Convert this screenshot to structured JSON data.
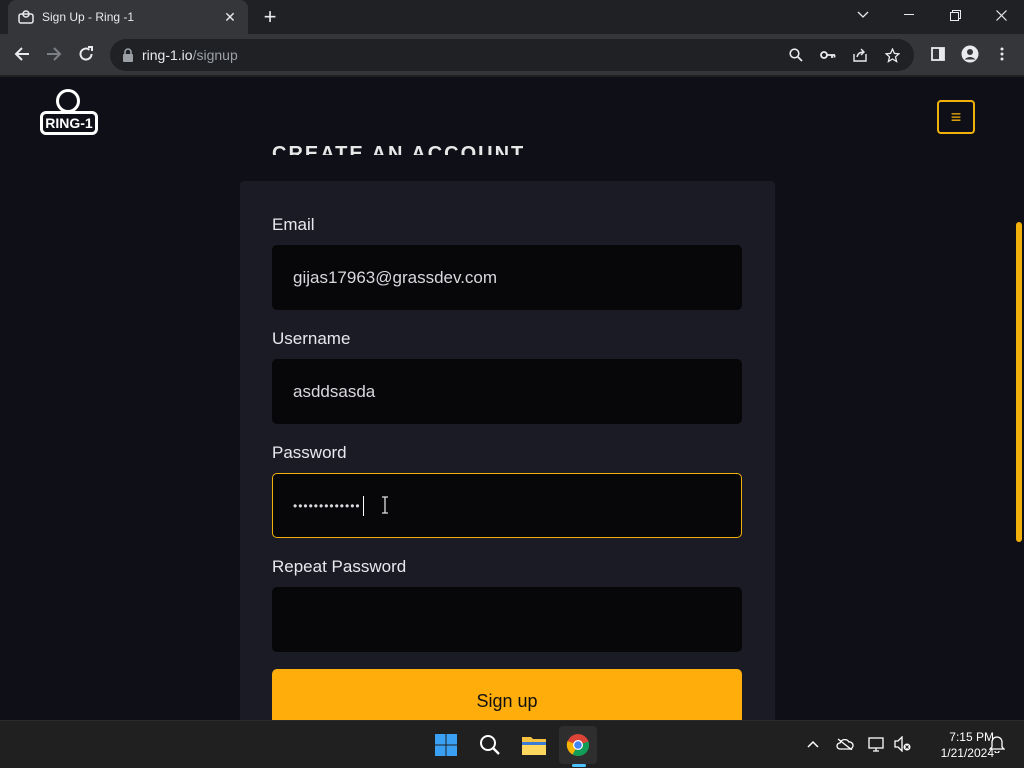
{
  "browser": {
    "tab_title": "Sign Up - Ring -1",
    "tab_close": "✕",
    "new_tab": "+",
    "url_host": "ring-1.io",
    "url_path": "/signup"
  },
  "site": {
    "logo_text": "RING-1",
    "menu_icon": "≡",
    "heading": "CREATE AN ACCOUNT"
  },
  "form": {
    "email_label": "Email",
    "email_value": "gijas17963@grassdev.com",
    "username_label": "Username",
    "username_value": "asddsasda",
    "password_label": "Password",
    "password_value": "•••••••••••••",
    "repeat_label": "Repeat Password",
    "repeat_value": "",
    "submit_label": "Sign up"
  },
  "taskbar": {
    "time": "7:15 PM",
    "date": "1/21/2024"
  },
  "colors": {
    "accent": "#f2b00a",
    "button": "#ffad0a",
    "page_bg": "#0f0f17",
    "card_bg": "#1b1b26",
    "input_bg": "#070709"
  }
}
